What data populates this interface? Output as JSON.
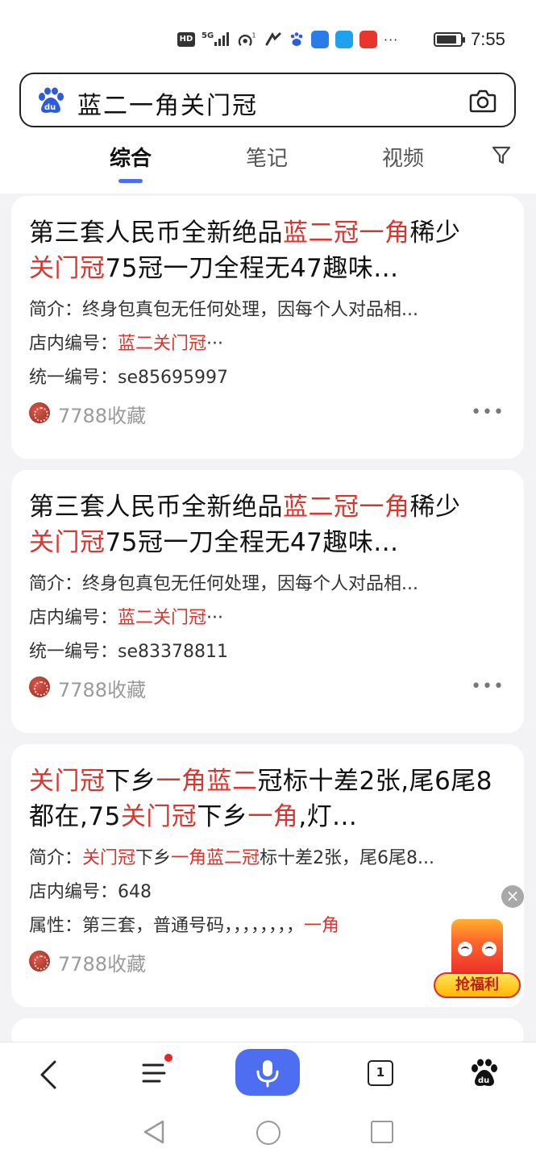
{
  "status_bar": {
    "hd": "HD",
    "network": "5G",
    "nfc_badge": "1",
    "more": "···",
    "time": "7:55",
    "battery_level": 0.75
  },
  "search": {
    "query": "蓝二一角关门冠"
  },
  "tabs": [
    {
      "label": "综合",
      "active": true
    },
    {
      "label": "笔记",
      "active": false
    },
    {
      "label": "视频",
      "active": false
    }
  ],
  "results": [
    {
      "title_parts": [
        {
          "text": "第三套人民币全新绝品",
          "hl": false
        },
        {
          "text": "蓝二冠一角",
          "hl": true
        },
        {
          "text": "稀少",
          "hl": false
        },
        {
          "text": "关门冠",
          "hl": true
        },
        {
          "text": "75冠一刀全程无47趣味...",
          "hl": false
        }
      ],
      "intro_label": "简介：",
      "intro_text": "终身包真包无任何处理，因每个人对品相...",
      "shop_label": "店内编号：",
      "shop_value": "蓝二关门冠",
      "shop_tail": "···",
      "uid_label": "统一编号：",
      "uid_value": "se85695997",
      "source": "7788收藏"
    },
    {
      "title_parts": [
        {
          "text": "第三套人民币全新绝品",
          "hl": false
        },
        {
          "text": "蓝二冠一角",
          "hl": true
        },
        {
          "text": "稀少",
          "hl": false
        },
        {
          "text": "关门冠",
          "hl": true
        },
        {
          "text": "75冠一刀全程无47趣味...",
          "hl": false
        }
      ],
      "intro_label": "简介：",
      "intro_text": "终身包真包无任何处理，因每个人对品相...",
      "shop_label": "店内编号：",
      "shop_value": "蓝二关门冠",
      "shop_tail": "···",
      "uid_label": "统一编号：",
      "uid_value": "se83378811",
      "source": "7788收藏"
    },
    {
      "title_parts": [
        {
          "text": "关门冠",
          "hl": true
        },
        {
          "text": "下乡",
          "hl": false
        },
        {
          "text": "一角蓝二",
          "hl": true
        },
        {
          "text": "冠标十差2张,尾6尾8都在,75",
          "hl": false
        },
        {
          "text": "关门冠",
          "hl": true
        },
        {
          "text": "下乡",
          "hl": false
        },
        {
          "text": "一角",
          "hl": true
        },
        {
          "text": ",灯...",
          "hl": false
        }
      ],
      "intro_label": "简介：",
      "intro_parts": [
        {
          "text": "关门冠",
          "hl": true
        },
        {
          "text": "下乡",
          "hl": false
        },
        {
          "text": "一角蓝二冠",
          "hl": true
        },
        {
          "text": "标十差2张，尾6尾8...",
          "hl": false
        }
      ],
      "shop_label": "店内编号：",
      "shop_value": "648",
      "attr_label": "属性：",
      "attr_text": "第三套，普通号码，，，，，，，，",
      "attr_hl": "一角",
      "source": "7788收藏"
    }
  ],
  "promo": {
    "label": "抢福利",
    "close": "×"
  },
  "bottom_nav": {
    "tab_count": "1"
  }
}
